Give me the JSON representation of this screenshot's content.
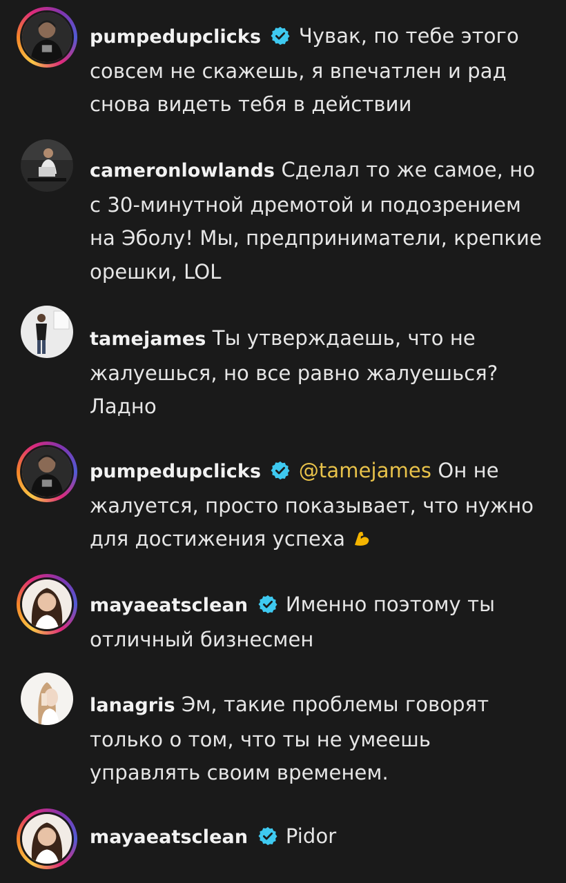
{
  "comments": [
    {
      "username": "pumpedupclicks",
      "verified": true,
      "mention": "",
      "text": "Чувак, по тебе этого совсем не скажешь, я впечатлен и рад снова видеть тебя в действии",
      "emoji": ""
    },
    {
      "username": "cameronlowlands",
      "verified": false,
      "mention": "",
      "text": "Сделал то же самое, но с 30-минутной дремотой и подозрением на Эболу! Мы, предприниматели, крепкие орешки, LOL",
      "emoji": ""
    },
    {
      "username": "tamejames",
      "verified": false,
      "mention": "",
      "text": "Ты утверждаешь, что не жалуешься, но все равно жалуешься? Ладно",
      "emoji": ""
    },
    {
      "username": "pumpedupclicks",
      "verified": true,
      "mention": "@tamejames",
      "text": "Он не жалуется, просто показывает, что нужно для достижения успеха",
      "emoji": "flexed-biceps"
    },
    {
      "username": "mayaeatsclean",
      "verified": true,
      "mention": "",
      "text": "Именно поэтому ты отличный бизнесмен",
      "emoji": ""
    },
    {
      "username": "lanagris",
      "verified": false,
      "mention": "",
      "text": "Эм, такие проблемы говорят только о том, что ты не умеешь управлять своим временем.",
      "emoji": ""
    },
    {
      "username": "mayaeatsclean",
      "verified": true,
      "mention": "",
      "text": "Pidor",
      "emoji": ""
    }
  ],
  "colors": {
    "background": "#1a1a1a",
    "verified_badge": "#3ec9f0",
    "mention": "#e8c24a"
  }
}
